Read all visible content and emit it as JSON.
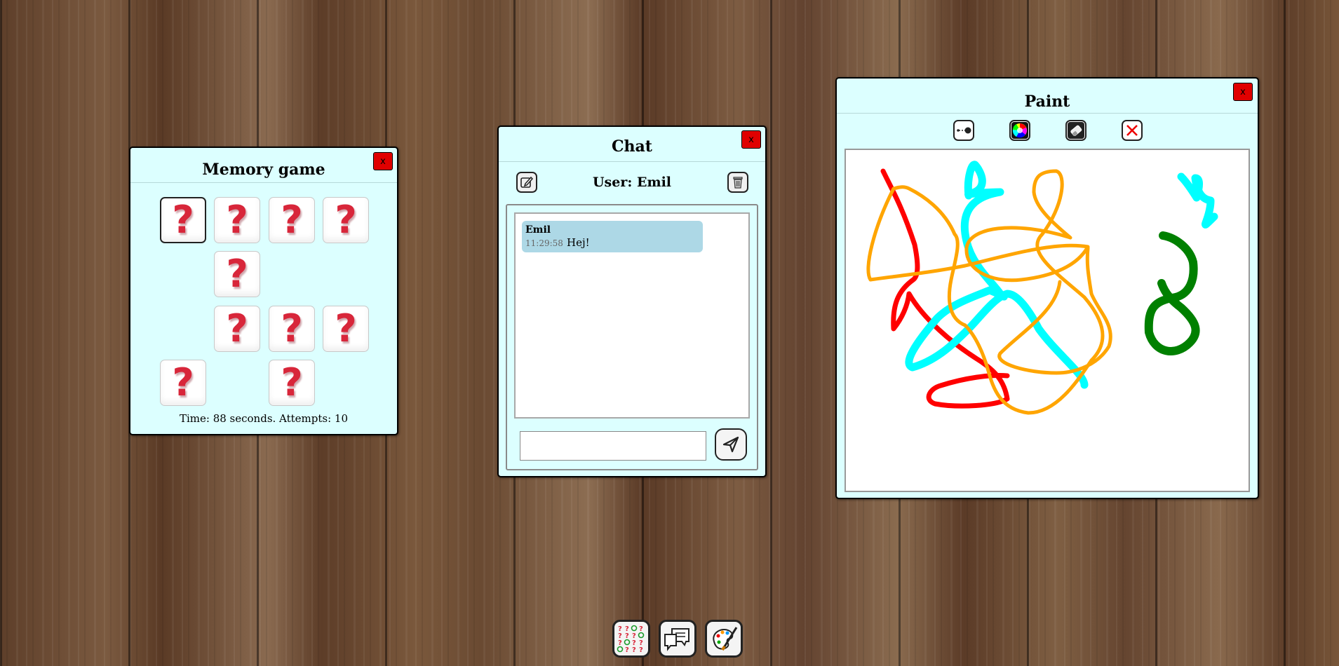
{
  "memory": {
    "title": "Memory game",
    "close_label": "x",
    "card_symbol": "?",
    "status": "Time: 88 seconds. Attempts: 10"
  },
  "chat": {
    "title": "Chat",
    "close_label": "x",
    "user_label": "User: Emil",
    "messages": [
      {
        "author": "Emil",
        "time": "11:29:58",
        "text": "Hej!"
      }
    ],
    "input_value": ""
  },
  "paint": {
    "title": "Paint",
    "close_label": "x",
    "stroke_colors": [
      "#ff0000",
      "#ffa500",
      "#00ffff",
      "#008000"
    ]
  },
  "dock": {
    "apps": [
      "memory-game",
      "chat",
      "paint"
    ]
  }
}
